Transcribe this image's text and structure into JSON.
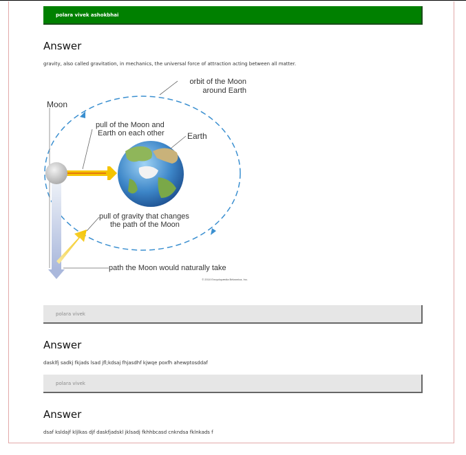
{
  "header": {
    "user_name": "polara vivek ashokbhai"
  },
  "questions": [
    {
      "answer_heading": "Answer",
      "answer_text": "gravity, also called gravitation, in mechanics, the universal force of attraction acting between all matter.",
      "figure": {
        "label_orbit_line1": "orbit of the Moon",
        "label_orbit_line2": "around Earth",
        "label_moon": "Moon",
        "label_pull_line1": "pull of the Moon and",
        "label_pull_line2": "Earth on each other",
        "label_earth": "Earth",
        "label_gravity_line1": "pull of gravity that changes",
        "label_gravity_line2": "the path of the Moon",
        "label_path": "path the Moon would naturally take",
        "credit": "© 2010 Encyclopædia Britannica, Inc."
      }
    },
    {
      "asker": "polara vivek",
      "answer_heading": "Answer",
      "answer_text": "dasklfj sadkj fkjads lsad jfl;kdsaj fhjasdhf kjwqe poxfh ahewptosddaf"
    },
    {
      "asker": "polara vivek",
      "answer_heading": "Answer",
      "answer_text": "dsaf ksldajf kljlkas djf daskfjadskl jklsadj fkhhbcasd cnkndsa fklnkads f"
    }
  ],
  "colors": {
    "header_bar": "#008000",
    "question_bar": "#e6e6e6",
    "orbit": "#3a8fd0"
  }
}
